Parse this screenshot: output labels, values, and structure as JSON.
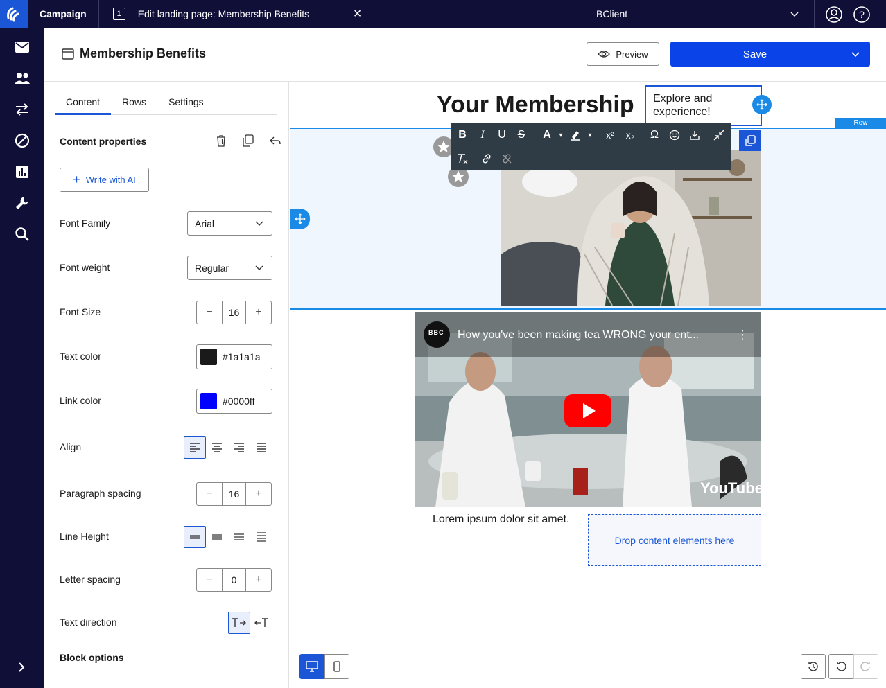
{
  "app": {
    "brand": "Campaign",
    "tab_title": "Edit landing page: Membership Benefits",
    "tab_number": "1",
    "client": "BClient"
  },
  "header": {
    "page_title": "Membership Benefits",
    "preview_label": "Preview",
    "save_label": "Save"
  },
  "panel": {
    "tabs": [
      {
        "label": "Content",
        "active": true
      },
      {
        "label": "Rows",
        "active": false
      },
      {
        "label": "Settings",
        "active": false
      }
    ],
    "section_title": "Content properties",
    "write_ai_label": "Write with AI",
    "font_family": {
      "label": "Font Family",
      "value": "Arial"
    },
    "font_weight": {
      "label": "Font weight",
      "value": "Regular"
    },
    "font_size": {
      "label": "Font Size",
      "value": "16"
    },
    "text_color": {
      "label": "Text color",
      "value": "#1a1a1a"
    },
    "link_color": {
      "label": "Link color",
      "value": "#0000ff"
    },
    "align": {
      "label": "Align"
    },
    "paragraph_spacing": {
      "label": "Paragraph spacing",
      "value": "16"
    },
    "line_height": {
      "label": "Line Height"
    },
    "letter_spacing": {
      "label": "Letter spacing",
      "value": "0"
    },
    "text_direction": {
      "label": "Text direction"
    },
    "block_options": "Block options"
  },
  "canvas": {
    "headline": "Your Membership",
    "edit_text_line1": "Explore and",
    "edit_text_line2": "experience!",
    "row_tag": "Row",
    "video_title": "How you've been making tea WRONG your ent...",
    "video_channel_logo": "BBC",
    "youtube_label": "YouTube",
    "lorem": "Lorem ipsum dolor sit amet.",
    "drop_label": "Drop content elements here"
  },
  "colors": {
    "nav_bg": "#0f0f38",
    "accent": "#1a56d6",
    "save": "#0a43e8",
    "row_highlight": "#1a8ae6"
  }
}
